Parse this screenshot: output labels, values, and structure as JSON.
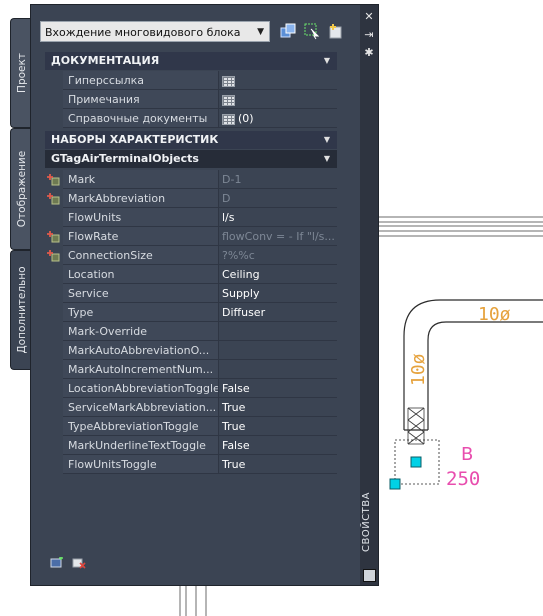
{
  "tabs": [
    "Проект",
    "Отображение",
    "Дополнительно"
  ],
  "selector": {
    "value": "Вхождение многовидового блока"
  },
  "palette_title": "СВОЙСТВА",
  "documentation": {
    "header": "ДОКУМЕНТАЦИЯ",
    "rows": [
      {
        "name": "Гиперссылка",
        "value": ""
      },
      {
        "name": "Примечания",
        "value": ""
      },
      {
        "name": "Справочные документы",
        "value": "(0)"
      }
    ]
  },
  "property_sets": {
    "header": "НАБОРЫ ХАРАКТЕРИСТИК",
    "subheader": "GTagAirTerminalObjects",
    "rows": [
      {
        "name": "Mark",
        "value": "D-1",
        "dim": true,
        "linked": true
      },
      {
        "name": "MarkAbbreviation",
        "value": "D",
        "dim": true,
        "linked": true
      },
      {
        "name": "FlowUnits",
        "value": "l/s",
        "dim": false,
        "linked": false
      },
      {
        "name": "FlowRate",
        "value": "flowConv = - If \"l/s...",
        "dim": true,
        "linked": true
      },
      {
        "name": "ConnectionSize",
        "value": "?%%c",
        "dim": true,
        "linked": true
      },
      {
        "name": "Location",
        "value": "Ceiling",
        "dim": false,
        "linked": false
      },
      {
        "name": "Service",
        "value": "Supply",
        "dim": false,
        "linked": false
      },
      {
        "name": "Type",
        "value": "Diffuser",
        "dim": false,
        "linked": false
      },
      {
        "name": "Mark-Override",
        "value": "",
        "dim": false,
        "linked": false
      },
      {
        "name": "MarkAutoAbbreviationO...",
        "value": "",
        "dim": false,
        "linked": false
      },
      {
        "name": "MarkAutoIncrementNum...",
        "value": "",
        "dim": false,
        "linked": false
      },
      {
        "name": "LocationAbbreviationToggle",
        "value": "False",
        "dim": false,
        "linked": false
      },
      {
        "name": "ServiceMarkAbbreviation...",
        "value": "True",
        "dim": false,
        "linked": false
      },
      {
        "name": "TypeAbbreviationToggle",
        "value": "True",
        "dim": false,
        "linked": false
      },
      {
        "name": "MarkUnderlineTextToggle",
        "value": "False",
        "dim": false,
        "linked": false
      },
      {
        "name": "FlowUnitsToggle",
        "value": "True",
        "dim": false,
        "linked": false
      }
    ]
  },
  "drawing": {
    "duct_label_h": "10ø",
    "duct_label_v": "10ø",
    "tag_letter": "B",
    "tag_number": "250",
    "colors": {
      "duct": "#ffffff",
      "text_duct": "#e6a23c",
      "tag": "#e84dae",
      "grip": "#00d1e6"
    }
  }
}
